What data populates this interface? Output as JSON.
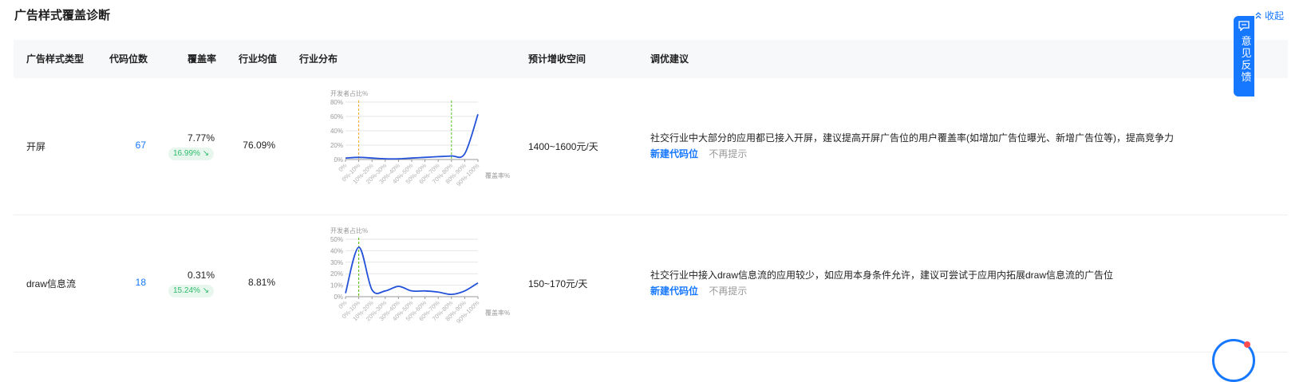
{
  "header": {
    "title": "广告样式覆盖诊断",
    "collapse_label": "收起"
  },
  "table": {
    "columns": [
      "广告样式类型",
      "代码位数",
      "覆盖率",
      "行业均值",
      "行业分布",
      "预计增收空间",
      "调优建议"
    ]
  },
  "rows": [
    {
      "type": "开屏",
      "count": "67",
      "coverage": "7.77%",
      "badge": "16.99% ↘",
      "avg": "76.09%",
      "space": "1400~1600元/天",
      "advice": "社交行业中大部分的应用都已接入开屏，建议提高开屏广告位的用户覆盖率(如增加广告位曝光、新增广告位等)，提高竞争力",
      "action_new": "新建代码位",
      "action_ignore": "不再提示"
    },
    {
      "type": "draw信息流",
      "count": "18",
      "coverage": "0.31%",
      "badge": "15.24% ↘",
      "avg": "8.81%",
      "space": "150~170元/天",
      "advice": "社交行业中接入draw信息流的应用较少，如应用本身条件允许，建议可尝试于应用内拓展draw信息流的广告位",
      "action_new": "新建代码位",
      "action_ignore": "不再提示"
    }
  ],
  "chart_data": [
    {
      "type": "line",
      "ylabel": "开发者占比%",
      "xlabel": "覆盖率%",
      "categories": [
        "0%",
        "0%-10%",
        "10%-20%",
        "20%-30%",
        "30%-40%",
        "40%-50%",
        "50%-60%",
        "60%-70%",
        "70%-80%",
        "80%-90%",
        "90%-100%"
      ],
      "yticks": [
        "0%",
        "20%",
        "40%",
        "60%",
        "80%"
      ],
      "ylim": [
        0,
        80
      ],
      "series": [
        {
          "values": [
            2,
            3,
            2,
            1,
            1,
            2,
            3,
            4,
            5,
            8,
            63
          ]
        }
      ],
      "marker_lines": [
        {
          "category_index": 1,
          "color": "#f5a623"
        },
        {
          "category_index": 8,
          "color": "#52c41a"
        }
      ],
      "color": "#2452d9"
    },
    {
      "type": "line",
      "ylabel": "开发者占比%",
      "xlabel": "覆盖率%",
      "categories": [
        "0%",
        "0%-10%",
        "10%-20%",
        "20%-30%",
        "30%-40%",
        "40%-50%",
        "50%-60%",
        "60%-70%",
        "70%-80%",
        "80%-90%",
        "90%-100%"
      ],
      "yticks": [
        "0%",
        "10%",
        "20%",
        "30%",
        "40%",
        "50%"
      ],
      "ylim": [
        0,
        50
      ],
      "series": [
        {
          "values": [
            3,
            43,
            6,
            5,
            9,
            5,
            5,
            4,
            2,
            5,
            12
          ]
        }
      ],
      "marker_lines": [
        {
          "category_index": 1,
          "color": "#f5a623"
        },
        {
          "category_index": 1,
          "color": "#52c41a"
        }
      ],
      "color": "#2452d9"
    }
  ],
  "feedback": {
    "label": "意见反馈"
  },
  "colors": {
    "accent": "#1677ff",
    "badge_bg": "#e8f7ee",
    "badge_fg": "#2dbb6b",
    "line": "#2452d9"
  },
  "icons": {
    "collapse": "chevron-double-up-icon",
    "feedback": "message-icon"
  }
}
